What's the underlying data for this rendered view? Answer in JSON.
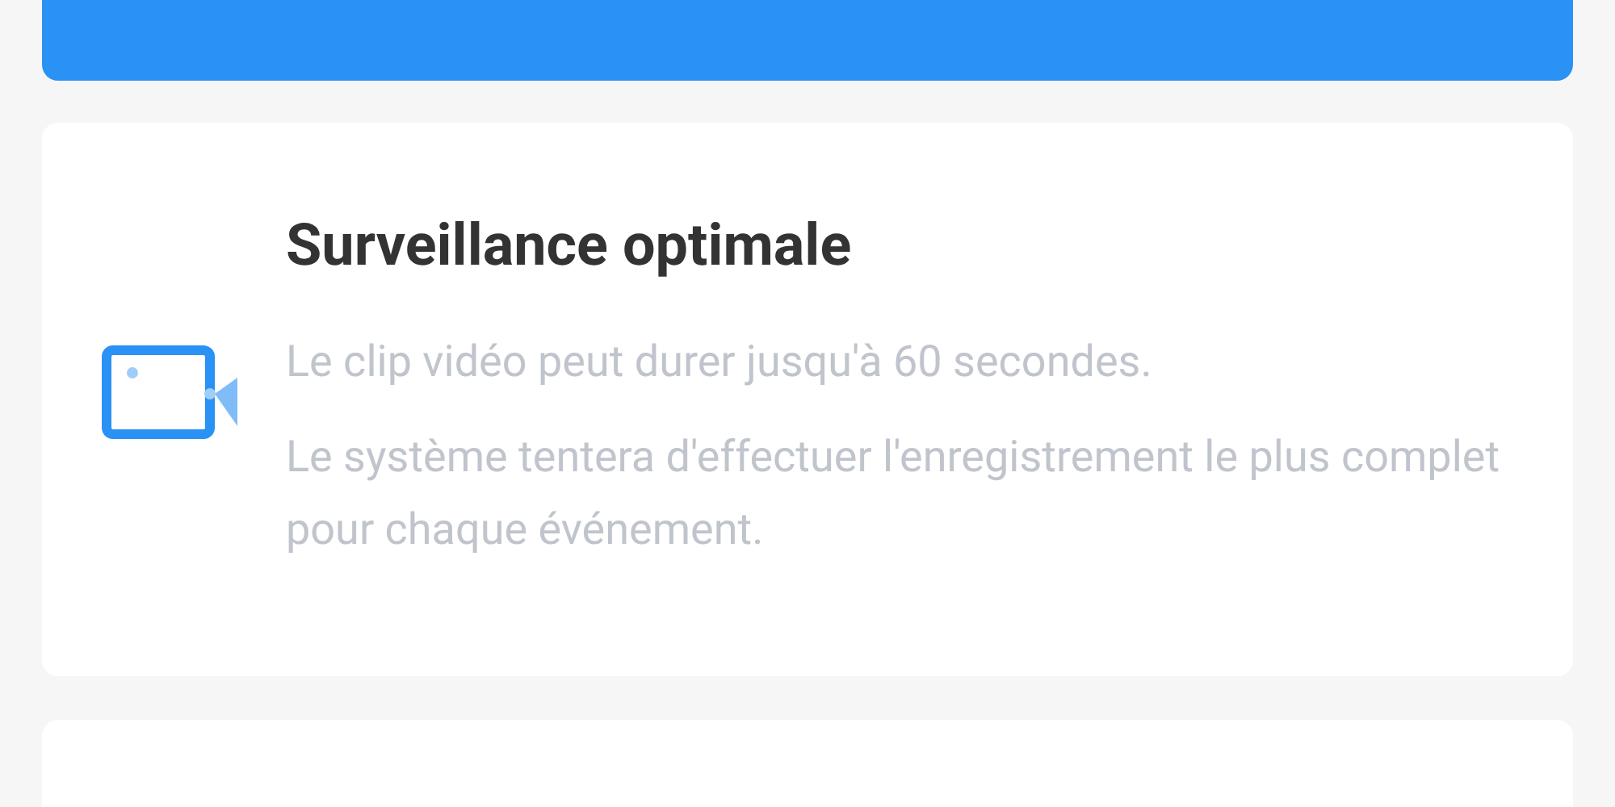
{
  "card": {
    "title": "Surveillance optimale",
    "lines": [
      "Le clip vidéo peut durer jusqu'à 60 secondes.",
      "Le système tentera d'effectuer l'enregistrement le plus complet pour chaque événement."
    ]
  }
}
